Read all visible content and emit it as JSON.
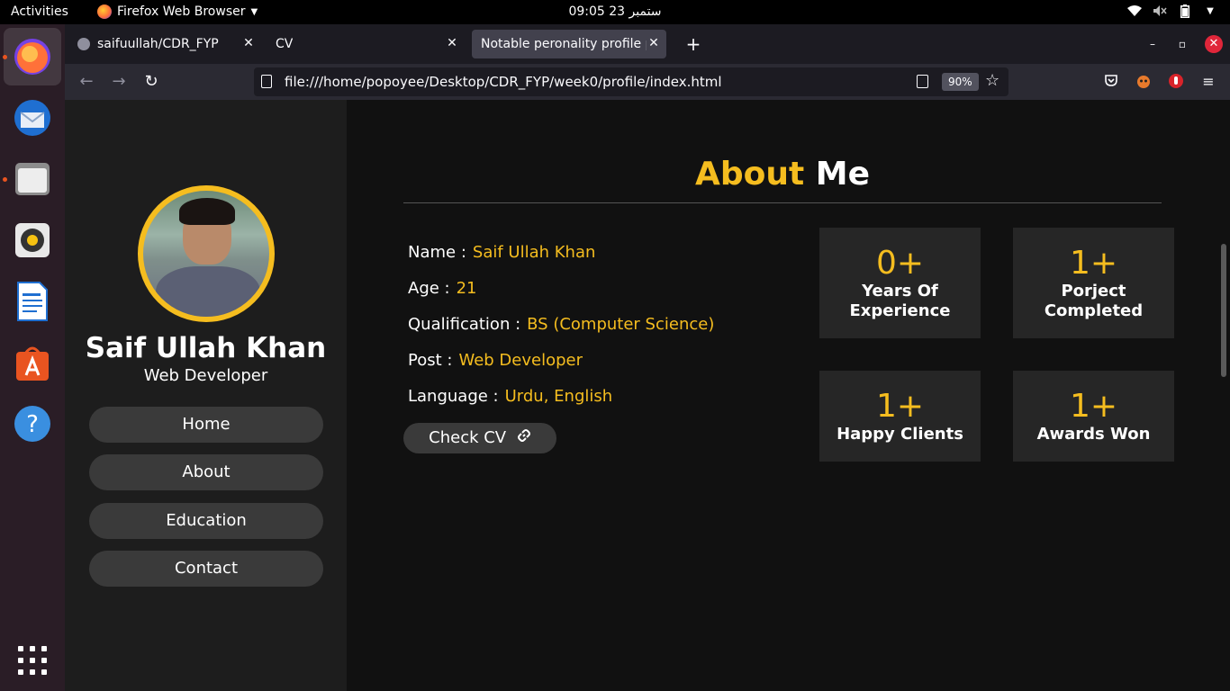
{
  "system": {
    "activities": "Activities",
    "app_name": "Firefox Web Browser",
    "clock": "09:05  23 ستمبر"
  },
  "browser": {
    "tabs": [
      {
        "title": "saifuullah/CDR_FYP"
      },
      {
        "title": "CV"
      },
      {
        "title": "Notable peronality profile pa"
      }
    ],
    "url": "file:///home/popoyee/Desktop/CDR_FYP/week0/profile/index.html",
    "zoom": "90%"
  },
  "sidebar": {
    "name": "Saif Ullah Khan",
    "role": "Web Developer",
    "menu": [
      "Home",
      "About",
      "Education",
      "Contact"
    ]
  },
  "about": {
    "heading_accent": "About",
    "heading_rest": "Me",
    "info": [
      {
        "label": "Name :",
        "value": "Saif Ullah Khan"
      },
      {
        "label": "Age :",
        "value": "21"
      },
      {
        "label": "Qualification :",
        "value": "BS (Computer Science)"
      },
      {
        "label": "Post :",
        "value": "Web Developer"
      },
      {
        "label": "Language :",
        "value": "Urdu, English"
      }
    ],
    "cv_button": "Check CV",
    "stats": [
      {
        "number": "0+",
        "line1": "Years Of",
        "line2": "Experience"
      },
      {
        "number": "1+",
        "line1": "Porject",
        "line2": "Completed"
      },
      {
        "number": "1+",
        "line1": "Happy Clients",
        "line2": ""
      },
      {
        "number": "1+",
        "line1": "Awards Won",
        "line2": ""
      }
    ]
  },
  "colors": {
    "accent": "#f5bd1f",
    "sidebar_bg": "#1d1d1d",
    "page_bg": "#111111",
    "dock_bg": "#2a1d26"
  }
}
